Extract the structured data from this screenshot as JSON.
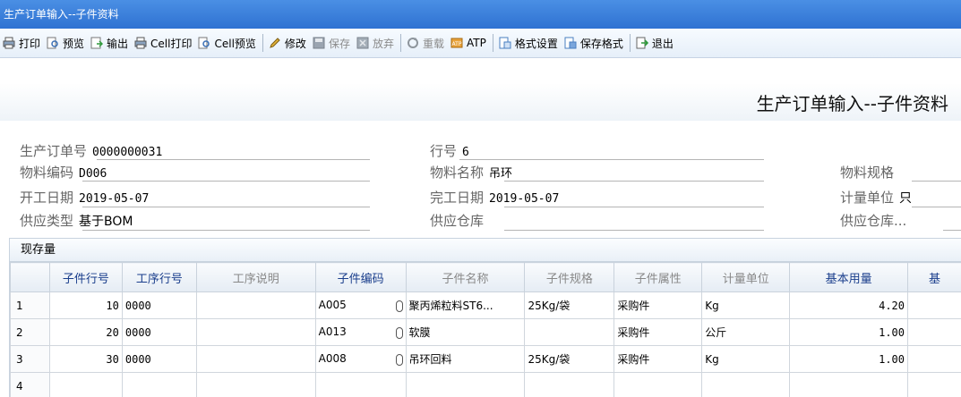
{
  "window": {
    "title": "生产订单输入--子件资料"
  },
  "toolbar": {
    "items": [
      {
        "label": "打印",
        "icon": "printer-icon",
        "enabled": true
      },
      {
        "label": "预览",
        "icon": "preview-icon",
        "enabled": true
      },
      {
        "label": "输出",
        "icon": "export-icon",
        "enabled": true
      },
      {
        "label": "Cell打印",
        "icon": "printer-icon",
        "enabled": true
      },
      {
        "label": "Cell预览",
        "icon": "preview-icon",
        "enabled": true
      },
      {
        "label": "修改",
        "icon": "pencil-icon",
        "enabled": true
      },
      {
        "label": "保存",
        "icon": "save-icon",
        "enabled": false
      },
      {
        "label": "放弃",
        "icon": "discard-icon",
        "enabled": false
      },
      {
        "label": "重载",
        "icon": "reload-icon",
        "enabled": false
      },
      {
        "label": "ATP",
        "icon": "atp-icon",
        "enabled": true
      },
      {
        "label": "格式设置",
        "icon": "format-icon",
        "enabled": true
      },
      {
        "label": "保存格式",
        "icon": "format-save-icon",
        "enabled": true
      },
      {
        "label": "退出",
        "icon": "exit-icon",
        "enabled": true
      }
    ]
  },
  "form": {
    "title": "生产订单输入--子件资料",
    "order_no": {
      "label": "生产订单号",
      "value": "0000000031"
    },
    "line_no": {
      "label": "行号",
      "value": "6"
    },
    "item_code": {
      "label": "物料编码",
      "value": "D006"
    },
    "item_name": {
      "label": "物料名称",
      "value": "吊环"
    },
    "item_spec": {
      "label": "物料规格",
      "value": ""
    },
    "start_date": {
      "label": "开工日期",
      "value": "2019-05-07"
    },
    "end_date": {
      "label": "完工日期",
      "value": "2019-05-07"
    },
    "unit": {
      "label": "计量单位",
      "value": "只"
    },
    "supply_type": {
      "label": "供应类型",
      "value": "基于BOM"
    },
    "warehouse": {
      "label": "供应仓库",
      "value": ""
    },
    "warehouse2": {
      "label": "供应仓库...",
      "value": ""
    }
  },
  "grid": {
    "caption": "现存量",
    "columns": [
      "子件行号",
      "工序行号",
      "工序说明",
      "子件编码",
      "子件名称",
      "子件规格",
      "子件属性",
      "计量单位",
      "基本用量",
      "基"
    ],
    "rows": [
      {
        "n": "1",
        "line": "10",
        "op": "0000",
        "desc": "",
        "code": "A005",
        "name": "聚丙烯粒料ST6...",
        "spec": "25Kg/袋",
        "attr": "采购件",
        "unit": "Kg",
        "qty": "4.20"
      },
      {
        "n": "2",
        "line": "20",
        "op": "0000",
        "desc": "",
        "code": "A013",
        "name": "软膜",
        "spec": "",
        "attr": "采购件",
        "unit": "公斤",
        "qty": "1.00"
      },
      {
        "n": "3",
        "line": "30",
        "op": "0000",
        "desc": "",
        "code": "A008",
        "name": "吊环回料",
        "spec": "25Kg/袋",
        "attr": "采购件",
        "unit": "Kg",
        "qty": "1.00"
      },
      {
        "n": "4",
        "line": "",
        "op": "",
        "desc": "",
        "code": "",
        "name": "",
        "spec": "",
        "attr": "",
        "unit": "",
        "qty": ""
      }
    ]
  }
}
